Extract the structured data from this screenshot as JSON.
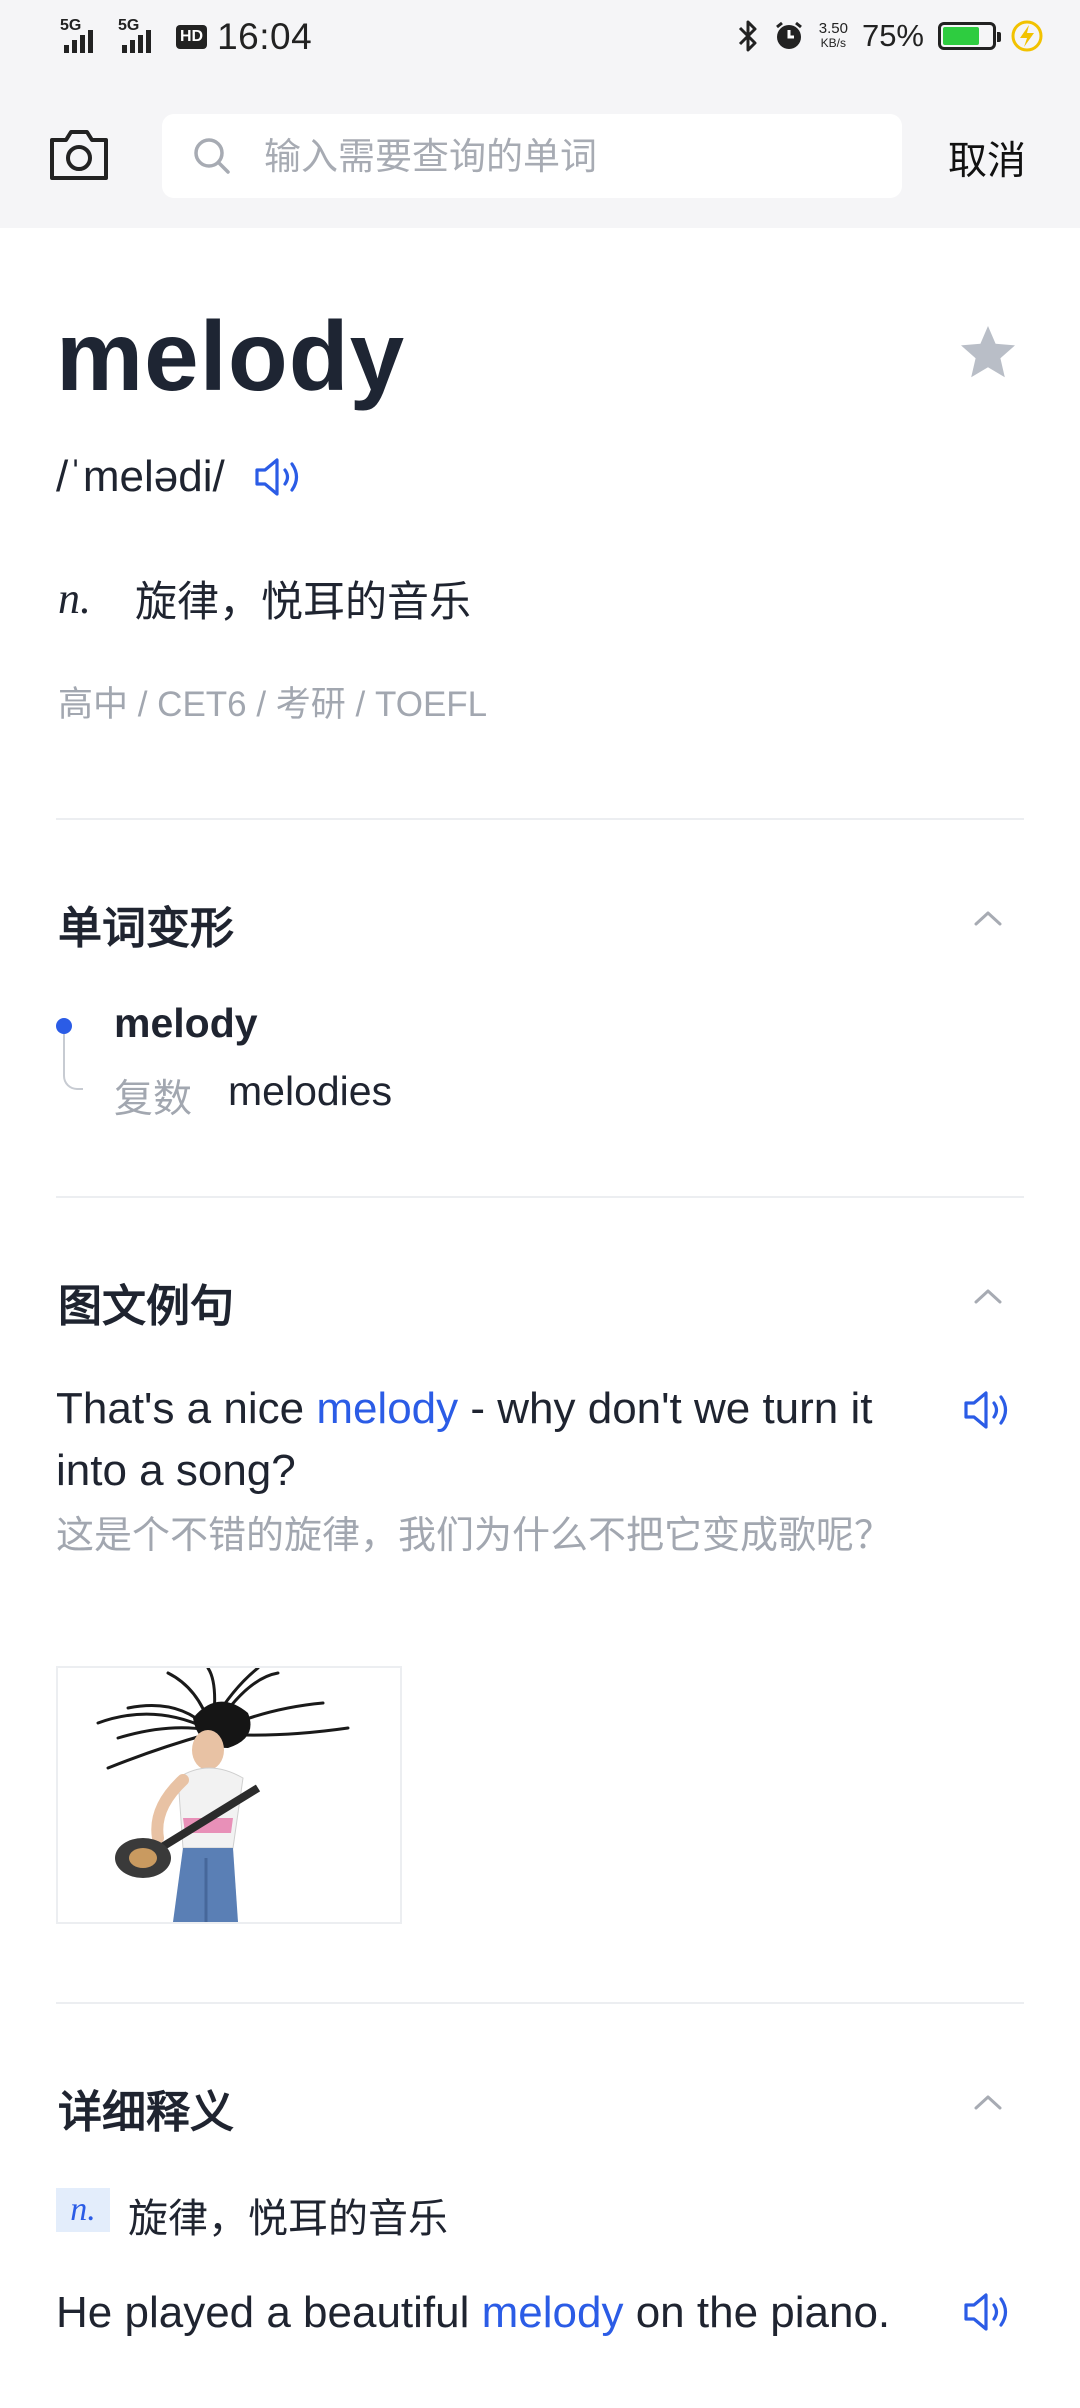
{
  "status_bar": {
    "net1": "5G",
    "net2": "5G",
    "hd": "HD",
    "time": "16:04",
    "speed_value": "3.50",
    "speed_unit": "KB/s",
    "battery_percent": "75%",
    "battery_level": 0.75,
    "battery_color": "#2ecc40"
  },
  "search": {
    "placeholder": "输入需要查询的单词",
    "value": "",
    "cancel_label": "取消"
  },
  "word": {
    "headword": "melody",
    "phonetic": "/ˈmelədi/",
    "pos": "n.",
    "definition": "旋律，悦耳的音乐",
    "levels": "高中 / CET6 / 考研 / TOEFL"
  },
  "forms": {
    "title": "单词变形",
    "base": "melody",
    "label": "复数",
    "value": "melodies"
  },
  "examples": {
    "title": "图文例句",
    "sentence_before": "That's a nice ",
    "sentence_highlight": "melody",
    "sentence_after": " - why don't we turn it into a song?",
    "translation": "这是个不错的旋律，我们为什么不把它变成歌呢？"
  },
  "detailed": {
    "title": "详细释义",
    "pos": "n.",
    "definition": "旋律，悦耳的音乐",
    "sentence_before": "He played a beautiful ",
    "sentence_highlight": "melody",
    "sentence_after": " on the piano."
  },
  "colors": {
    "accent": "#2b5ce6",
    "muted": "#a2a7b0",
    "star": "#b9bec7"
  },
  "icons": [
    "camera-icon",
    "search-icon",
    "star-icon",
    "speaker-icon",
    "chevron-up-icon"
  ]
}
